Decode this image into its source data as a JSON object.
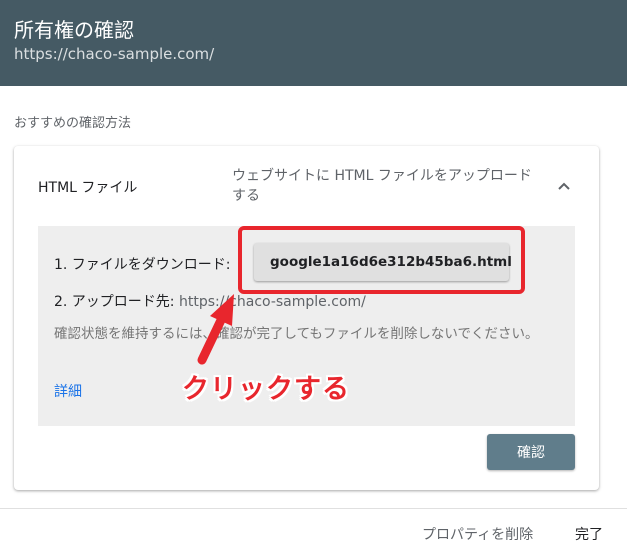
{
  "header": {
    "title": "所有権の確認",
    "subtitle": "https://chaco-sample.com/"
  },
  "section_label": "おすすめの確認方法",
  "method_card": {
    "title": "HTML ファイル",
    "description": "ウェブサイトに HTML ファイルをアップロードする",
    "chevron_icon": "chevron-up-icon"
  },
  "steps": {
    "step1_label": "1. ファイルをダウンロード:",
    "download_filename": "google1a16d6e312b45ba6.html",
    "download_icon": "download-icon",
    "step2_label": "2. アップロード先:",
    "step2_url": "https://chaco-sample.com/",
    "note": "確認状態を維持するには、確認が完了してもファイルを削除しないでください。",
    "details_link": "詳細"
  },
  "annotation": {
    "text": "クリックする",
    "color": "#e8262d"
  },
  "verify_button": "確認",
  "footer": {
    "delete_property": "プロパティを削除",
    "done": "完了"
  },
  "colors": {
    "header_bg": "#455a64",
    "primary_button": "#607d8b",
    "link": "#1a73e8"
  }
}
